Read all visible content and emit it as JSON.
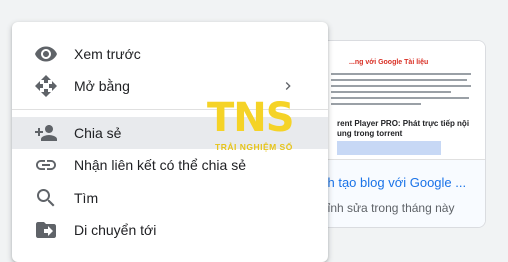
{
  "background_card": {
    "thumbnail_title": "...ng với Google Tài liệu",
    "thumbnail_heading_1": "rent Player PRO: Phát trực tiếp nội",
    "thumbnail_heading_2": "ung trong torrent",
    "name": "ch tạo blog với Google ...",
    "subtitle": "hỉnh sửa trong tháng này"
  },
  "menu": {
    "items": [
      {
        "label": "Xem trước",
        "icon": "eye-icon"
      },
      {
        "label": "Mở bằng",
        "icon": "move-arrows-icon",
        "submenu_icon": "chevron-right-icon"
      },
      {
        "label": "Chia sẻ",
        "icon": "person-add-icon"
      },
      {
        "label": "Nhận liên kết có thể chia sẻ",
        "icon": "link-icon"
      },
      {
        "label": "Tìm",
        "icon": "search-icon"
      },
      {
        "label": "Di chuyển tới",
        "icon": "folder-move-icon"
      }
    ],
    "active_item": "Chia sẻ"
  },
  "watermark": {
    "brand": "TNS",
    "tagline": "TRẢI NGHIỆM SỐ"
  },
  "colors": {
    "link_blue": "#1a73e8",
    "icon_gray": "#5f6368",
    "active_bg": "#e8eaed",
    "logo_yellow": "#f5d327"
  }
}
